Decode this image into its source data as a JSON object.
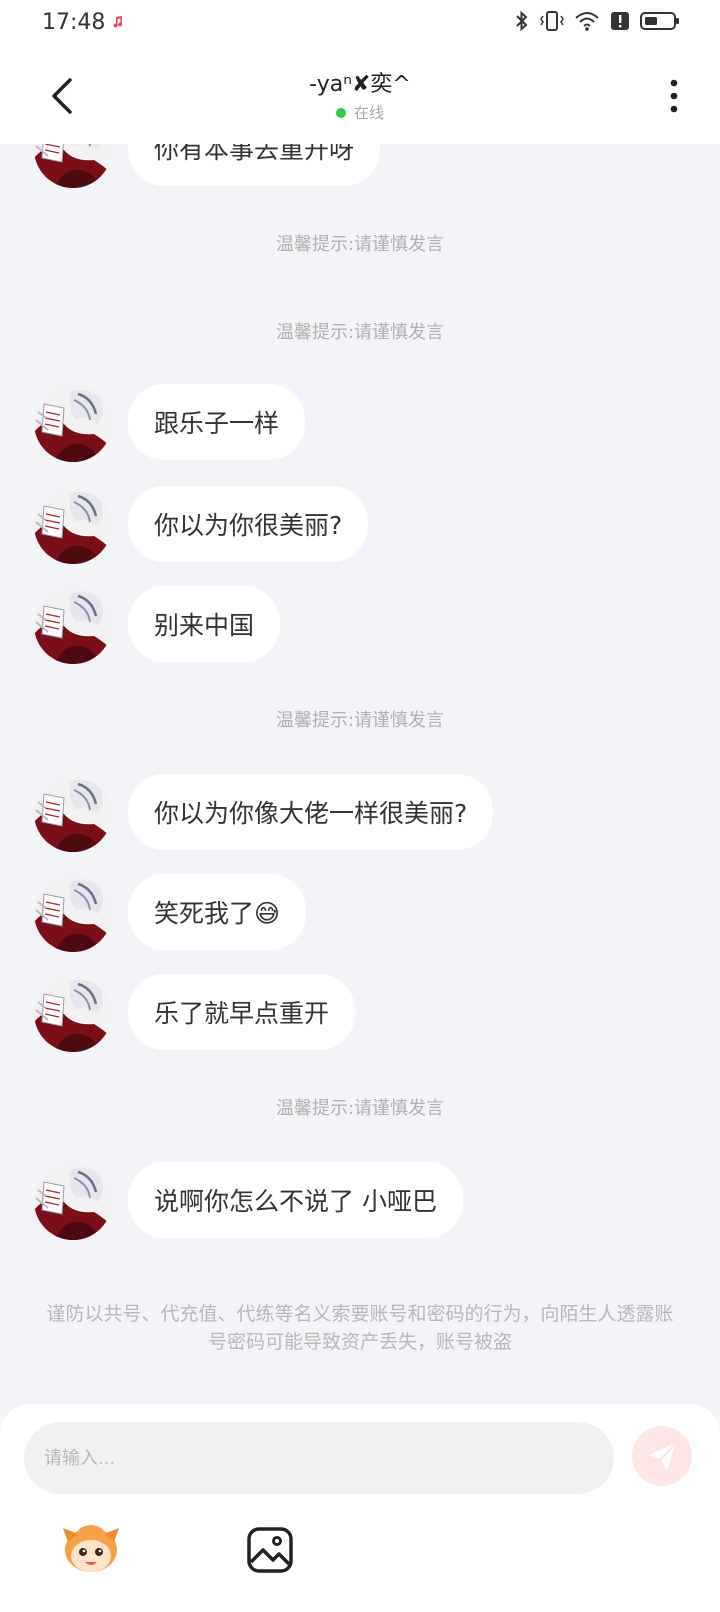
{
  "status_bar": {
    "time": "17:48",
    "icons": [
      "music-app-icon",
      "bluetooth-icon",
      "vibrate-icon",
      "wifi-icon",
      "alert-icon",
      "battery-icon"
    ]
  },
  "header": {
    "title": "-yaⁿ✘奕^",
    "status": "在线",
    "status_color": "#2ecc40"
  },
  "messages": [
    {
      "type": "text",
      "text": "你有本事去重开呀"
    },
    {
      "type": "tip",
      "text": "温馨提示:请谨慎发言"
    },
    {
      "type": "tip",
      "text": "温馨提示:请谨慎发言"
    },
    {
      "type": "text",
      "text": "跟乐子一样"
    },
    {
      "type": "text",
      "text": "你以为你很美丽?"
    },
    {
      "type": "text",
      "text": "别来中国"
    },
    {
      "type": "tip",
      "text": "温馨提示:请谨慎发言"
    },
    {
      "type": "text",
      "text": "你以为你像大佬一样很美丽?"
    },
    {
      "type": "text",
      "text": "笑死我了😅"
    },
    {
      "type": "text",
      "text": "乐了就早点重开"
    },
    {
      "type": "tip",
      "text": "温馨提示:请谨慎发言"
    },
    {
      "type": "text",
      "text": "说啊你怎么不说了  小哑巴"
    }
  ],
  "safety_notice": "谨防以共号、代充值、代练等名义索要账号和密码的行为，向陌生人透露账号密码可能导致资产丢失，账号被盗",
  "composer": {
    "placeholder": "请输入...",
    "send_color": "#f08080",
    "buttons": [
      "emoji-mascot-icon",
      "image-icon"
    ]
  }
}
